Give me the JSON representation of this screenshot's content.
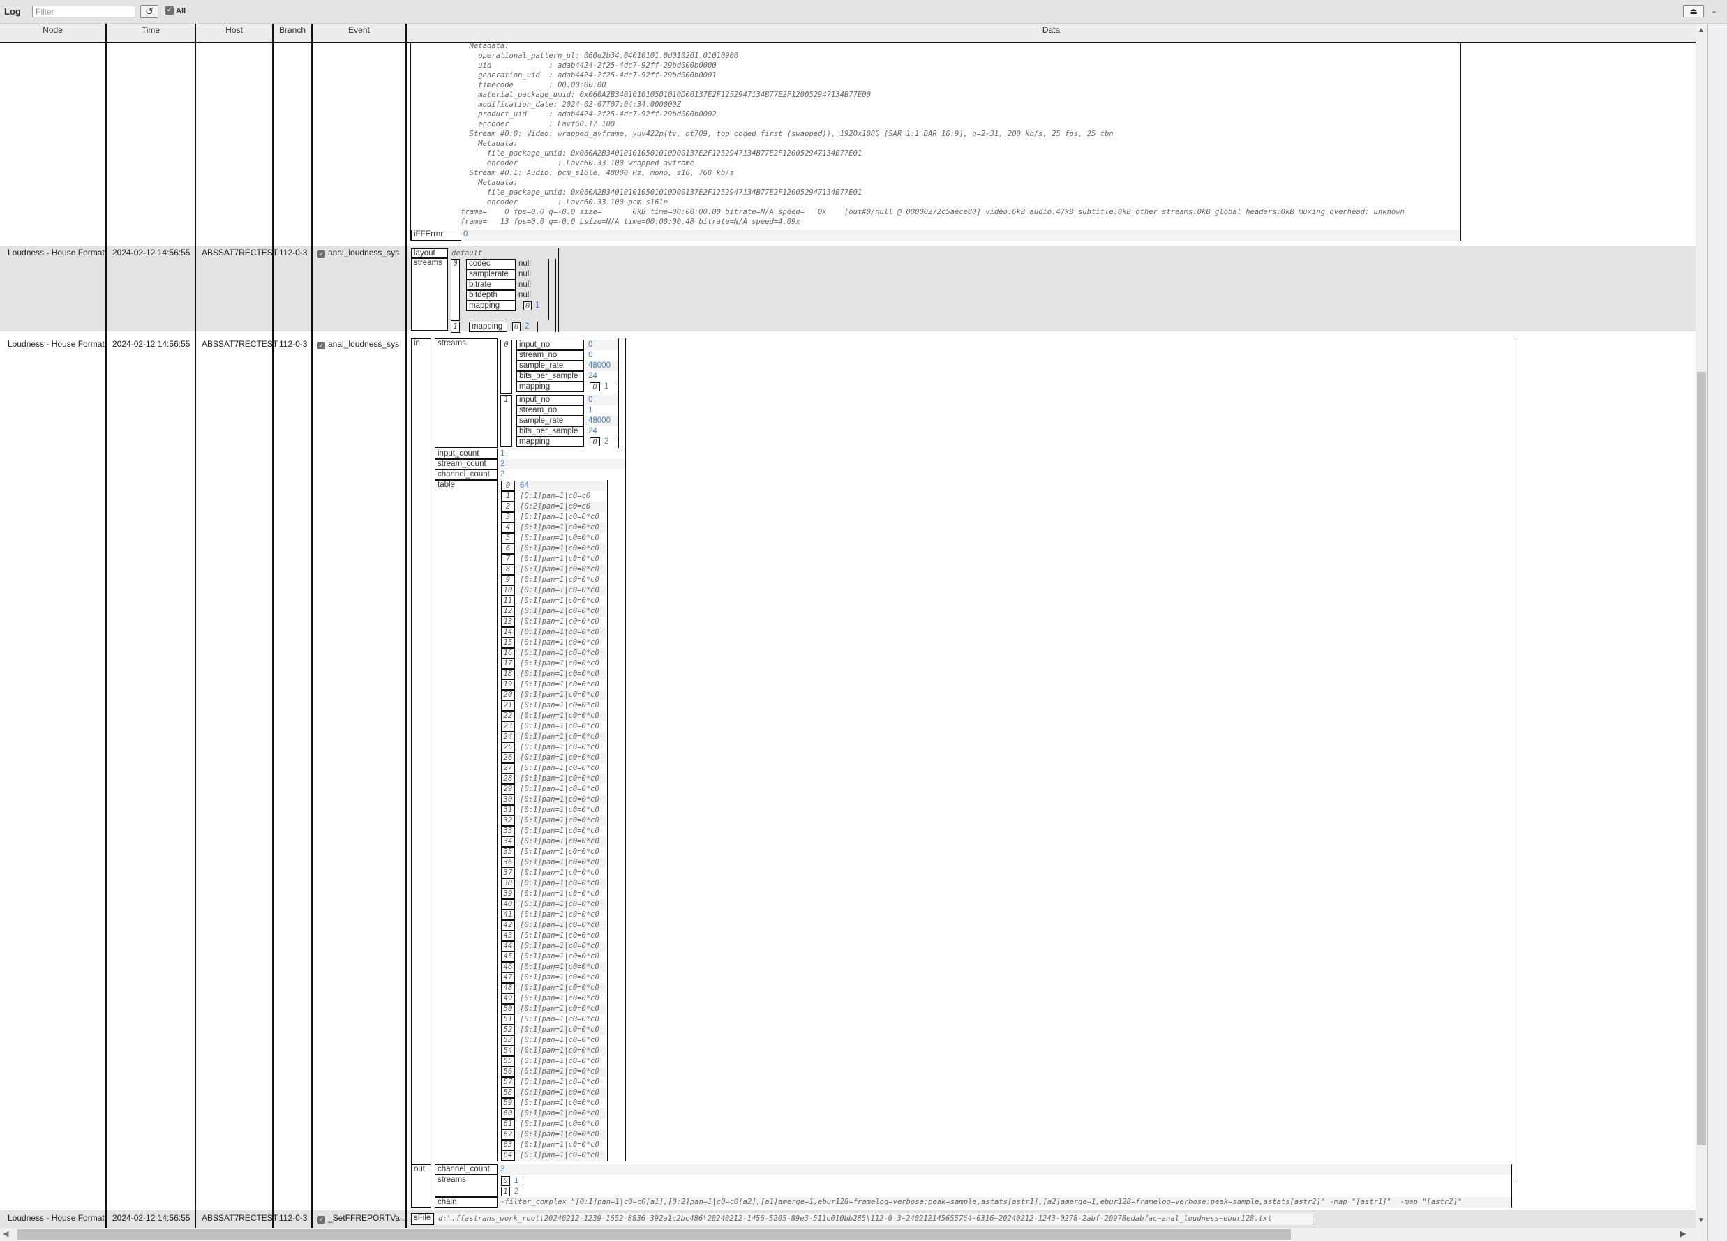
{
  "toolbar": {
    "title": "Log",
    "filter_placeholder": "Filter",
    "filter_value": "",
    "reset_icon": "↺",
    "all_checked": true,
    "all_label": "All",
    "eject_icon": "⏏",
    "menu_icon": "⌄"
  },
  "columns": [
    "Node",
    "Time",
    "Host",
    "Branch",
    "Event",
    "Data"
  ],
  "rows": [
    {
      "node": "",
      "time": "",
      "host": "",
      "branch": "",
      "event": "",
      "data": {
        "log_lines": [
          "  Metadata:",
          "    operational_pattern_ul: 060e2b34.04010101.0d010201.01010900",
          "    uid             : adab4424-2f25-4dc7-92ff-29bd000b0000",
          "    generation_uid  : adab4424-2f25-4dc7-92ff-29bd000b0001",
          "    timecode        : 00:00:00:00",
          "    material_package_umid: 0x060A2B340101010501010D00137E2F1252947134B77E2F120052947134B77E00",
          "    modification_date: 2024-02-07T07:04:34.000000Z",
          "    product_uid     : adab4424-2f25-4dc7-92ff-29bd000b0002",
          "    encoder         : Lavf60.17.100",
          "  Stream #0:0: Video: wrapped_avframe, yuv422p(tv, bt709, top coded first (swapped)), 1920x1080 [SAR 1:1 DAR 16:9], q=2-31, 200 kb/s, 25 fps, 25 tbn",
          "    Metadata:",
          "      file_package_umid: 0x060A2B340101010501010D00137E2F1252947134B77E2F120052947134B77E01",
          "      encoder         : Lavc60.33.100 wrapped_avframe",
          "  Stream #0:1: Audio: pcm_s16le, 48000 Hz, mono, s16, 768 kb/s",
          "    Metadata:",
          "      file_package_umid: 0x060A2B340101010501010D00137E2F1252947134B77E2F120052947134B77E01",
          "      encoder         : Lavc60.33.100 pcm_s16le",
          "frame=    0 fps=0.0 q=-0.0 size=       0kB time=00:00:00.00 bitrate=N/A speed=   0x    [out#0/null @ 00000272c5aece80] video:6kB audio:47kB subtitle:0kB other streams:0kB global headers:0kB muxing overhead: unknown",
          "frame=   13 fps=0.0 q=-0.0 Lsize=N/A time=00:00:00.48 bitrate=N/A speed=4.09x"
        ],
        "iFFError_key": "iFFError",
        "iFFError_value": "0"
      }
    },
    {
      "node": "Loudness - House Format",
      "time": "2024-02-12 14:56:55",
      "host": "ABSSAT7RECTEST",
      "branch": "112-0-3",
      "event": "anal_loudness_sys",
      "event_checked": true,
      "data": {
        "layout_key": "layout",
        "layout_value": "default",
        "streams_key": "streams",
        "streams": [
          {
            "index": "0",
            "fields": [
              {
                "k": "codec",
                "v": "null"
              },
              {
                "k": "samplerate",
                "v": "null"
              },
              {
                "k": "bitrate",
                "v": "null"
              },
              {
                "k": "bitdepth",
                "v": "null"
              }
            ],
            "mapping_key": "mapping",
            "mapping": [
              {
                "i": "0",
                "v": "1"
              }
            ]
          },
          {
            "index": "1",
            "mapping_key": "mapping",
            "mapping": [
              {
                "i": "0",
                "v": "2"
              }
            ]
          }
        ]
      }
    },
    {
      "node": "Loudness - House Format",
      "time": "2024-02-12 14:56:55",
      "host": "ABSSAT7RECTEST",
      "branch": "112-0-3",
      "event": "anal_loudness_sys",
      "event_checked": true,
      "data": {
        "in_key": "in",
        "streams_key": "streams",
        "streams": [
          {
            "index": "0",
            "input_no": "0",
            "stream_no": "0",
            "sample_rate": "48000",
            "bits_per_sample": "24",
            "mapping": [
              {
                "i": "0",
                "v": "1"
              }
            ]
          },
          {
            "index": "1",
            "input_no": "0",
            "stream_no": "1",
            "sample_rate": "48000",
            "bits_per_sample": "24",
            "mapping": [
              {
                "i": "0",
                "v": "2"
              }
            ]
          }
        ],
        "labels": {
          "input_no": "input_no",
          "stream_no": "stream_no",
          "sample_rate": "sample_rate",
          "bits_per_sample": "bits_per_sample",
          "mapping": "mapping"
        },
        "input_count_key": "input_count",
        "input_count": "1",
        "stream_count_key": "stream_count",
        "stream_count": "2",
        "channel_count_key": "channel_count",
        "channel_count": "2",
        "table_key": "table",
        "table_first_value": "64",
        "table_entries_1_2": [
          "[0:1]pan=1|c0=c0",
          "[0:2]pan=1|c0=c0"
        ],
        "table_entry_rest": "[0:1]pan=1|c0=0*c0",
        "table_count": 65,
        "out_key": "out",
        "out_channel_count_key": "channel_count",
        "out_channel_count": "2",
        "out_streams_key": "streams",
        "out_streams": [
          {
            "i": "0",
            "v": "1"
          },
          {
            "i": "1",
            "v": "2"
          }
        ],
        "chain_key": "chain",
        "chain_value": "-filter_complex \"[0:1]pan=1|c0=c0[a1],[0:2]pan=1|c0=c0[a2],[a1]amerge=1,ebur128=framelog=verbose:peak=sample,astats[astr1],[a2]amerge=1,ebur128=framelog=verbose:peak=sample,astats[astr2]\" -map \"[astr1]\"  -map \"[astr2]\""
      }
    },
    {
      "node": "Loudness - House Format",
      "time": "2024-02-12 14:56:55",
      "host": "ABSSAT7RECTEST",
      "branch": "112-0-3",
      "event": "_SetFFREPORTVa...",
      "event_checked": true,
      "data": {
        "sFile_key": "sFile",
        "sFile_value": "d:\\.ffastrans_work_root\\20240212-1239-1652-8836-392a1c2bc486\\20240212-1456-5205-89e3-511c010bb285\\112-0-3~240212145655764~6316~20240212-1243-0278-2abf-20978edabfac~anal_loudness~ebur128.txt"
      }
    }
  ],
  "scrollbars": {
    "vertical_position_fraction": 0.29,
    "vertical_visible_fraction": 0.64,
    "horizontal_position_fraction": 0.0,
    "horizontal_visible_fraction": 0.76
  }
}
